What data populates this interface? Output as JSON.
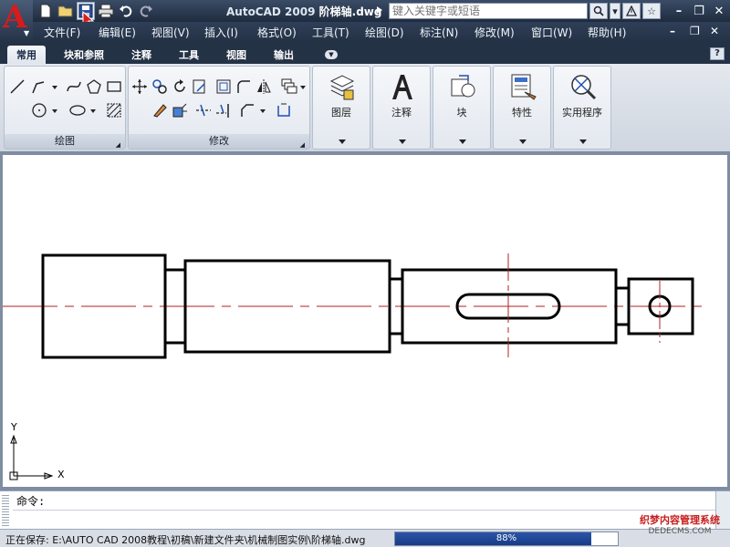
{
  "title": {
    "app": "AutoCAD 2009",
    "file": "阶梯轴.dwg"
  },
  "search": {
    "placeholder": "键入关键字或短语"
  },
  "menu": [
    "文件(F)",
    "编辑(E)",
    "视图(V)",
    "插入(I)",
    "格式(O)",
    "工具(T)",
    "绘图(D)",
    "标注(N)",
    "修改(M)",
    "窗口(W)",
    "帮助(H)"
  ],
  "ribbon_tabs": [
    "常用",
    "块和参照",
    "注释",
    "工具",
    "视图",
    "输出"
  ],
  "panels": {
    "draw": "绘图",
    "modify": "修改"
  },
  "big_panels": [
    "图层",
    "注释",
    "块",
    "特性",
    "实用程序"
  ],
  "help_label": "?",
  "ucs": {
    "x": "X",
    "y": "Y"
  },
  "command": {
    "prompt": "命令:"
  },
  "status": {
    "text": "正在保存: E:\\AUTO CAD 2008教程\\初稿\\新建文件夹\\机械制图实例\\阶梯轴.dwg",
    "progress": 88,
    "progress_label": "88%"
  },
  "watermark": {
    "main": "织梦内容管理系统",
    "sub": "DEDECMS.COM"
  },
  "colors": {
    "accent_red": "#d81b1b",
    "centerline": "#b22222",
    "progress": "#173b86"
  },
  "icons": [
    "new-icon",
    "open-icon",
    "save-icon",
    "print-icon",
    "undo-icon",
    "redo-icon",
    "search-icon",
    "star-icon"
  ]
}
